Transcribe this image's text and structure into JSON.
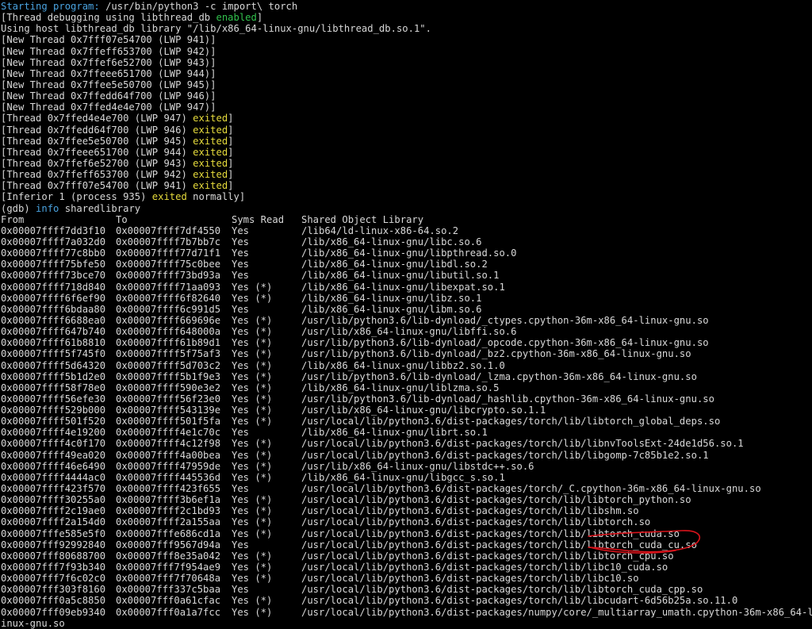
{
  "colors": {
    "background": "#000000",
    "text": "#d8d8d8",
    "blue": "#4aa3e0",
    "green": "#32c24d",
    "yellow": "#e6db3c",
    "annotation": "#d9131b"
  },
  "header": {
    "starting_word": "Starting program:",
    "starting_rest": " /usr/bin/python3 -c import\\ torch",
    "debug_pre": "[Thread debugging using libthread_db ",
    "debug_enabled": "enabled",
    "debug_post": "]",
    "host_lib": "Using host libthread_db library \"/lib/x86_64-linux-gnu/libthread_db.so.1\"."
  },
  "new_threads": [
    "[New Thread 0x7fff07e54700 (LWP 941)]",
    "[New Thread 0x7ffeff653700 (LWP 942)]",
    "[New Thread 0x7ffef6e52700 (LWP 943)]",
    "[New Thread 0x7ffeee651700 (LWP 944)]",
    "[New Thread 0x7ffee5e50700 (LWP 945)]",
    "[New Thread 0x7ffedd64f700 (LWP 946)]",
    "[New Thread 0x7ffed4e4e700 (LWP 947)]"
  ],
  "exited_threads": [
    {
      "pre": "[Thread 0x7ffed4e4e700 (LWP 947) ",
      "word": "exited",
      "post": "]"
    },
    {
      "pre": "[Thread 0x7ffedd64f700 (LWP 946) ",
      "word": "exited",
      "post": "]"
    },
    {
      "pre": "[Thread 0x7ffee5e50700 (LWP 945) ",
      "word": "exited",
      "post": "]"
    },
    {
      "pre": "[Thread 0x7ffeee651700 (LWP 944) ",
      "word": "exited",
      "post": "]"
    },
    {
      "pre": "[Thread 0x7ffef6e52700 (LWP 943) ",
      "word": "exited",
      "post": "]"
    },
    {
      "pre": "[Thread 0x7ffeff653700 (LWP 942) ",
      "word": "exited",
      "post": "]"
    },
    {
      "pre": "[Thread 0x7fff07e54700 (LWP 941) ",
      "word": "exited",
      "post": "]"
    }
  ],
  "inferior": {
    "pre": "[Inferior 1 (process 935) ",
    "word": "exited",
    "post": " normally]"
  },
  "command": {
    "prompt": "(gdb) ",
    "keyword": "info",
    "rest": " sharedlibrary"
  },
  "table": {
    "headers": {
      "from": "From",
      "to": "To",
      "syms": "Syms Read",
      "lib": "Shared Object Library"
    },
    "rows": [
      {
        "from": "0x00007ffff7dd3f10",
        "to": "0x00007ffff7df4550",
        "syms": "Yes",
        "lib": "/lib64/ld-linux-x86-64.so.2"
      },
      {
        "from": "0x00007ffff7a032d0",
        "to": "0x00007ffff7b7bb7c",
        "syms": "Yes",
        "lib": "/lib/x86_64-linux-gnu/libc.so.6"
      },
      {
        "from": "0x00007ffff77c8bb0",
        "to": "0x00007ffff77d71f1",
        "syms": "Yes",
        "lib": "/lib/x86_64-linux-gnu/libpthread.so.0"
      },
      {
        "from": "0x00007ffff75bfe50",
        "to": "0x00007ffff75c0bee",
        "syms": "Yes",
        "lib": "/lib/x86_64-linux-gnu/libdl.so.2"
      },
      {
        "from": "0x00007ffff73bce70",
        "to": "0x00007ffff73bd93a",
        "syms": "Yes",
        "lib": "/lib/x86_64-linux-gnu/libutil.so.1"
      },
      {
        "from": "0x00007ffff718d840",
        "to": "0x00007ffff71aa093",
        "syms": "Yes (*)",
        "lib": "/lib/x86_64-linux-gnu/libexpat.so.1"
      },
      {
        "from": "0x00007ffff6f6ef90",
        "to": "0x00007ffff6f82640",
        "syms": "Yes (*)",
        "lib": "/lib/x86_64-linux-gnu/libz.so.1"
      },
      {
        "from": "0x00007ffff6bdaa80",
        "to": "0x00007ffff6c991d5",
        "syms": "Yes",
        "lib": "/lib/x86_64-linux-gnu/libm.so.6"
      },
      {
        "from": "0x00007ffff6688ea0",
        "to": "0x00007ffff669696e",
        "syms": "Yes (*)",
        "lib": "/usr/lib/python3.6/lib-dynload/_ctypes.cpython-36m-x86_64-linux-gnu.so"
      },
      {
        "from": "0x00007ffff647b740",
        "to": "0x00007ffff648000a",
        "syms": "Yes (*)",
        "lib": "/usr/lib/x86_64-linux-gnu/libffi.so.6"
      },
      {
        "from": "0x00007ffff61b8810",
        "to": "0x00007ffff61b89d1",
        "syms": "Yes (*)",
        "lib": "/usr/lib/python3.6/lib-dynload/_opcode.cpython-36m-x86_64-linux-gnu.so"
      },
      {
        "from": "0x00007ffff5f745f0",
        "to": "0x00007ffff5f75af3",
        "syms": "Yes (*)",
        "lib": "/usr/lib/python3.6/lib-dynload/_bz2.cpython-36m-x86_64-linux-gnu.so"
      },
      {
        "from": "0x00007ffff5d64320",
        "to": "0x00007ffff5d703c2",
        "syms": "Yes (*)",
        "lib": "/lib/x86_64-linux-gnu/libbz2.so.1.0"
      },
      {
        "from": "0x00007ffff5b1d2e0",
        "to": "0x00007ffff5b1f9e3",
        "syms": "Yes (*)",
        "lib": "/usr/lib/python3.6/lib-dynload/_lzma.cpython-36m-x86_64-linux-gnu.so"
      },
      {
        "from": "0x00007ffff58f78e0",
        "to": "0x00007ffff590e3e2",
        "syms": "Yes (*)",
        "lib": "/lib/x86_64-linux-gnu/liblzma.so.5"
      },
      {
        "from": "0x00007ffff56efe30",
        "to": "0x00007ffff56f23e0",
        "syms": "Yes (*)",
        "lib": "/usr/lib/python3.6/lib-dynload/_hashlib.cpython-36m-x86_64-linux-gnu.so"
      },
      {
        "from": "0x00007ffff529b000",
        "to": "0x00007ffff543139e",
        "syms": "Yes (*)",
        "lib": "/usr/lib/x86_64-linux-gnu/libcrypto.so.1.1"
      },
      {
        "from": "0x00007ffff501f520",
        "to": "0x00007ffff501f5fa",
        "syms": "Yes (*)",
        "lib": "/usr/local/lib/python3.6/dist-packages/torch/lib/libtorch_global_deps.so"
      },
      {
        "from": "0x00007ffff4e19200",
        "to": "0x00007ffff4e1c70c",
        "syms": "Yes",
        "lib": "/lib/x86_64-linux-gnu/librt.so.1"
      },
      {
        "from": "0x00007ffff4c0f170",
        "to": "0x00007ffff4c12f98",
        "syms": "Yes (*)",
        "lib": "/usr/local/lib/python3.6/dist-packages/torch/lib/libnvToolsExt-24de1d56.so.1"
      },
      {
        "from": "0x00007ffff49ea020",
        "to": "0x00007ffff4a00bea",
        "syms": "Yes (*)",
        "lib": "/usr/local/lib/python3.6/dist-packages/torch/lib/libgomp-7c85b1e2.so.1"
      },
      {
        "from": "0x00007ffff46e6490",
        "to": "0x00007ffff47959de",
        "syms": "Yes (*)",
        "lib": "/usr/lib/x86_64-linux-gnu/libstdc++.so.6"
      },
      {
        "from": "0x00007ffff4444ac0",
        "to": "0x00007ffff445536d",
        "syms": "Yes (*)",
        "lib": "/lib/x86_64-linux-gnu/libgcc_s.so.1"
      },
      {
        "from": "0x00007ffff423f570",
        "to": "0x00007ffff423f655",
        "syms": "Yes",
        "lib": "/usr/local/lib/python3.6/dist-packages/torch/_C.cpython-36m-x86_64-linux-gnu.so"
      },
      {
        "from": "0x00007ffff30255a0",
        "to": "0x00007ffff3b6ef1a",
        "syms": "Yes (*)",
        "lib": "/usr/local/lib/python3.6/dist-packages/torch/lib/libtorch_python.so"
      },
      {
        "from": "0x00007ffff2c19ae0",
        "to": "0x00007ffff2c1bd93",
        "syms": "Yes (*)",
        "lib": "/usr/local/lib/python3.6/dist-packages/torch/lib/libshm.so"
      },
      {
        "from": "0x00007ffff2a154d0",
        "to": "0x00007ffff2a155aa",
        "syms": "Yes (*)",
        "lib": "/usr/local/lib/python3.6/dist-packages/torch/lib/libtorch.so"
      },
      {
        "from": "0x00007fffe585e5f0",
        "to": "0x00007fffe686cd1a",
        "syms": "Yes (*)",
        "lib": "/usr/local/lib/python3.6/dist-packages/torch/lib/libtorch_cuda.so"
      },
      {
        "from": "0x00007fff92992840",
        "to": "0x00007fff9567d94a",
        "syms": "Yes",
        "lib": "/usr/local/lib/python3.6/dist-packages/torch/lib/libtorch_cuda_cu.so"
      },
      {
        "from": "0x00007fff80688700",
        "to": "0x00007fff8e35a042",
        "syms": "Yes (*)",
        "lib": "/usr/local/lib/python3.6/dist-packages/torch/lib/libtorch_cpu.so"
      },
      {
        "from": "0x00007fff7f93b340",
        "to": "0x00007fff7f954ae9",
        "syms": "Yes (*)",
        "lib": "/usr/local/lib/python3.6/dist-packages/torch/lib/libc10_cuda.so"
      },
      {
        "from": "0x00007fff7f6c02c0",
        "to": "0x00007fff7f70648a",
        "syms": "Yes (*)",
        "lib": "/usr/local/lib/python3.6/dist-packages/torch/lib/libc10.so"
      },
      {
        "from": "0x00007fff303f8160",
        "to": "0x00007fff337c5baa",
        "syms": "Yes",
        "lib": "/usr/local/lib/python3.6/dist-packages/torch/lib/libtorch_cuda_cpp.so"
      },
      {
        "from": "0x00007fff0a5c8850",
        "to": "0x00007fff0a61cfac",
        "syms": "Yes (*)",
        "lib": "/usr/local/lib/python3.6/dist-packages/torch/lib/libcudart-6d56b25a.so.11.0"
      },
      {
        "from": "0x00007fff09eb9340",
        "to": "0x00007fff0a1a7fcc",
        "syms": "Yes (*)",
        "lib": "/usr/local/lib/python3.6/dist-packages/numpy/core/_multiarray_umath.cpython-36m-x86_64-l"
      }
    ],
    "wrap": "inux-gnu.so"
  }
}
